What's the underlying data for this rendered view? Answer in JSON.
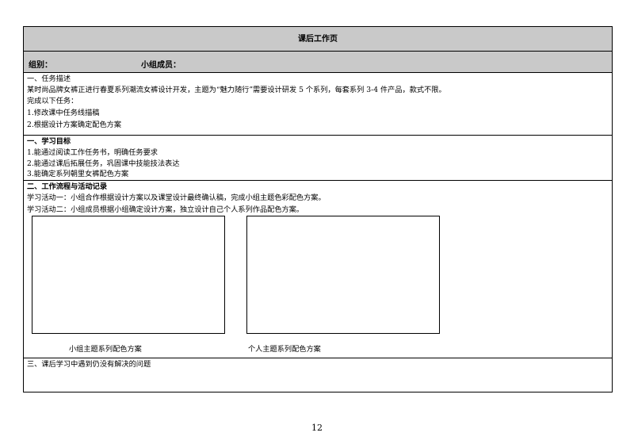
{
  "worksheet": {
    "title": "课后工作页",
    "group_label": "组别：",
    "members_label": "小组成员："
  },
  "section1": {
    "heading": "一、任务描述",
    "description": "某时尚品牌女裤正进行春夏系列潮流女裤设计开发，主题为“魅力随行”需要设计研发 5 个系列，每套系列 3-4 件产品，款式不限。",
    "instruction": "完成以下任务：",
    "tasks": [
      "1.修改课中任务线描稿",
      "2.根据设计方案确定配色方案"
    ]
  },
  "section2": {
    "heading": "一、学习目标",
    "goals": [
      "1.能通过阅读工作任务书，明确任务要求",
      "2.能通过课后拓展任务，巩固课中技能技法表达",
      "3.能确定系列朝里女裤配色方案"
    ]
  },
  "section3": {
    "heading": "二、工作流程与活动记录",
    "activities": [
      "学习活动一：小组合作根据设计方案以及课堂设计最终确认稿，完成小组主题色彩配色方案。",
      "学习活动二：小组成员根据小组确定设计方案，独立设计自己个人系列作品配色方案。"
    ],
    "captions": [
      "小组主题系列配色方案",
      "个人主题系列配色方案"
    ]
  },
  "section4": {
    "heading": "三、课后学习中遇到仍没有解决的问题"
  },
  "page_number": "12"
}
